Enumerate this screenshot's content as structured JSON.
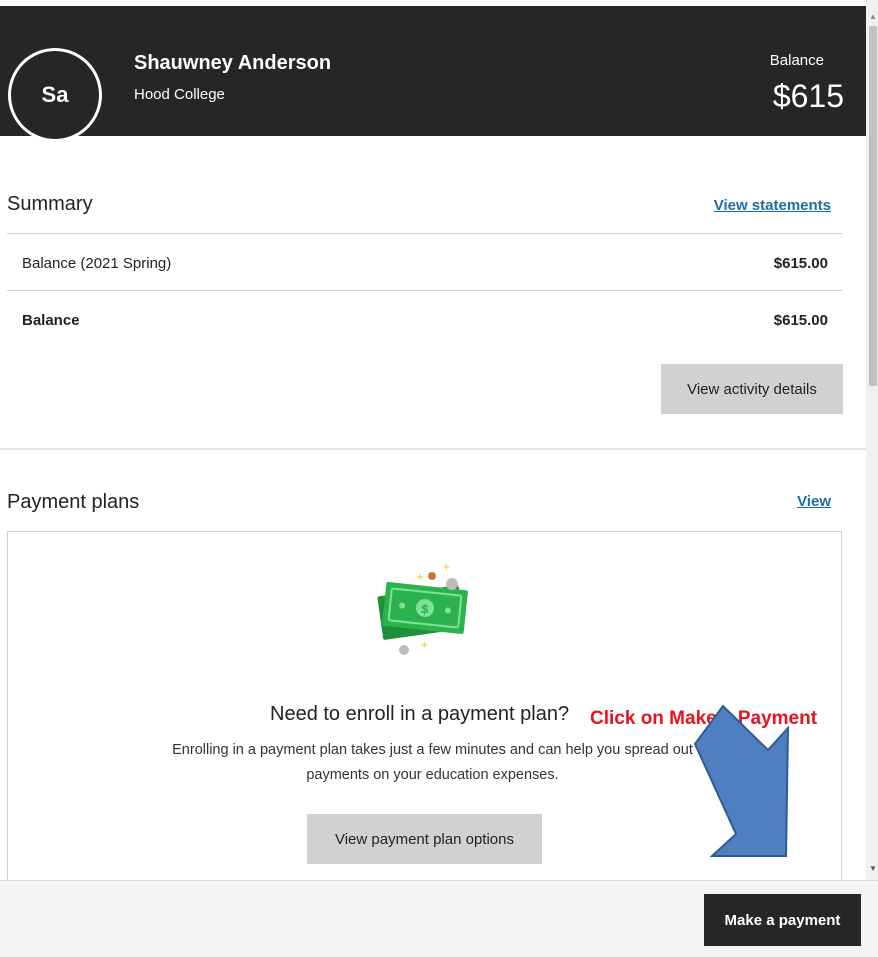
{
  "header": {
    "avatar_initials": "Sa",
    "user_name": "Shauwney Anderson",
    "school": "Hood College",
    "balance_label": "Balance",
    "balance_amount": "$615"
  },
  "summary": {
    "title": "Summary",
    "view_statements": "View statements",
    "rows": [
      {
        "label": "Balance (2021 Spring)",
        "value": "$615.00"
      },
      {
        "label": "Balance",
        "value": "$615.00"
      }
    ],
    "view_activity_button": "View activity details"
  },
  "payment_plans": {
    "title": "Payment plans",
    "view_link": "View",
    "heading": "Need to enroll in a payment plan?",
    "description": "Enrolling in a payment plan takes just a few minutes and can help you spread out payments on your education expenses.",
    "options_button": "View payment plan options"
  },
  "annotation": {
    "text": "Click on Make a Payment",
    "color": "#e8131f",
    "arrow_color": "#4f7fc0"
  },
  "footer": {
    "make_payment_button": "Make a payment"
  },
  "colors": {
    "header_bg": "#262626",
    "link": "#1b6ea8",
    "money_green": "#2bb24c"
  },
  "icons": [
    "money-illustration-icon",
    "scroll-up-icon",
    "scroll-down-icon",
    "arrow-annotation-icon"
  ]
}
